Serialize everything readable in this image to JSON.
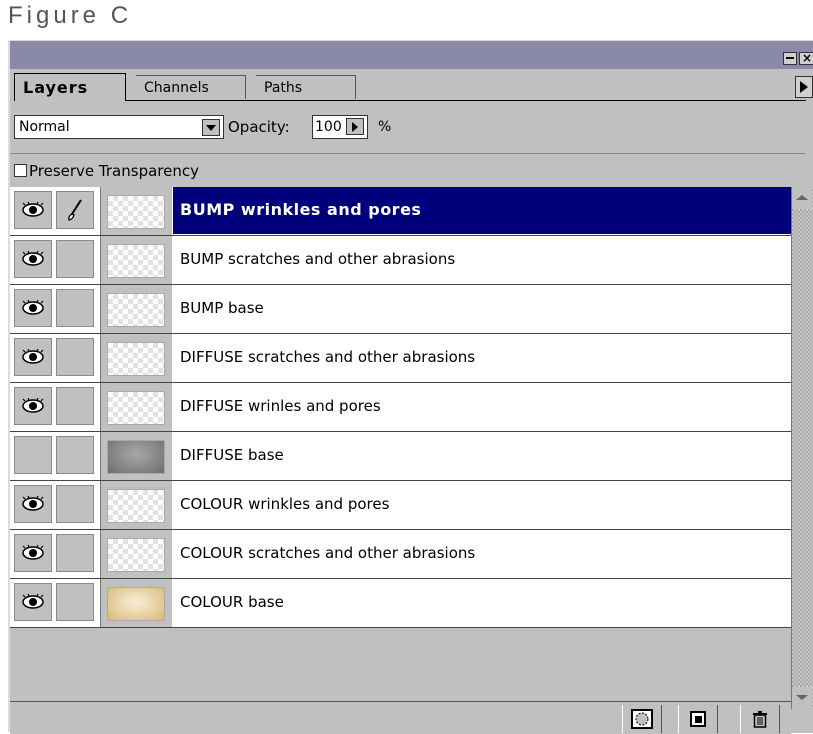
{
  "figure_caption": "Figure C",
  "tabs": [
    {
      "label": "Layers",
      "active": true
    },
    {
      "label": "Channels",
      "active": false
    },
    {
      "label": "Paths",
      "active": false
    }
  ],
  "blend_mode": "Normal",
  "opacity_label": "Opacity:",
  "opacity_value": "100",
  "opacity_unit": "%",
  "preserve_transparency_label": "Preserve Transparency",
  "preserve_transparency_checked": false,
  "selection_color": "#00007a",
  "layers": [
    {
      "name": "BUMP wrinkles and pores",
      "visible": true,
      "selected": true,
      "brush": true,
      "thumbnail": "checker"
    },
    {
      "name": "BUMP scratches and other abrasions",
      "visible": true,
      "selected": false,
      "brush": false,
      "thumbnail": "checker"
    },
    {
      "name": "BUMP base",
      "visible": true,
      "selected": false,
      "brush": false,
      "thumbnail": "checker"
    },
    {
      "name": "DIFFUSE scratches and other abrasions",
      "visible": true,
      "selected": false,
      "brush": false,
      "thumbnail": "checker"
    },
    {
      "name": "DIFFUSE wrinles and pores",
      "visible": true,
      "selected": false,
      "brush": false,
      "thumbnail": "checker"
    },
    {
      "name": "DIFFUSE base",
      "visible": false,
      "selected": false,
      "brush": false,
      "thumbnail": "gray-texture"
    },
    {
      "name": "COLOUR wrinkles and pores",
      "visible": true,
      "selected": false,
      "brush": false,
      "thumbnail": "checker"
    },
    {
      "name": "COLOUR scratches and other abrasions",
      "visible": true,
      "selected": false,
      "brush": false,
      "thumbnail": "checker"
    },
    {
      "name": "COLOUR base",
      "visible": true,
      "selected": false,
      "brush": false,
      "thumbnail": "tan-texture"
    }
  ],
  "bottom_buttons": [
    "mask-icon",
    "new-layer-icon",
    "trash-icon"
  ]
}
